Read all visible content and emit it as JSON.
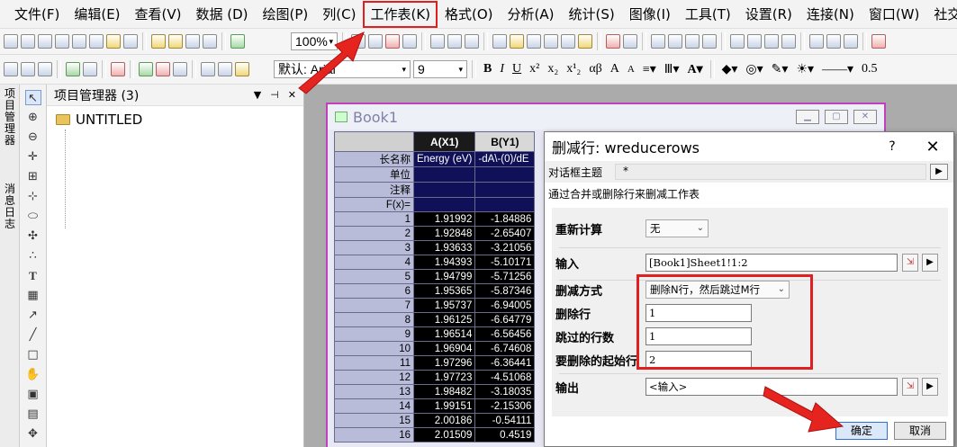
{
  "menubar": {
    "items": [
      "文件(F)",
      "编辑(E)",
      "查看(V)",
      "数据 (D)",
      "绘图(P)",
      "列(C)",
      "工作表(K)",
      "格式(O)",
      "分析(A)",
      "统计(S)",
      "图像(I)",
      "工具(T)",
      "设置(R)",
      "连接(N)",
      "窗口(W)",
      "社交("
    ],
    "highlighted_index": 6
  },
  "toolbar1": {
    "zoom": "100%"
  },
  "toolbar2": {
    "font_label": "默认: Arial",
    "font_size": "9",
    "format_buttons": [
      "B",
      "I",
      "U",
      "x²",
      "x₂",
      "x¹₂",
      "αβ",
      "A",
      "A"
    ],
    "line_width": "0.5"
  },
  "side_tabs": {
    "top": "项目管理器",
    "bottom": "消息日志"
  },
  "project_explorer": {
    "title": "项目管理器 (3)",
    "folder": "UNTITLED"
  },
  "book": {
    "title": "Book1"
  },
  "grid": {
    "columns": [
      "A(X1)",
      "B(Y1)"
    ],
    "label_rows": [
      {
        "name": "长名称",
        "a": "Energy (eV)",
        "b": "-dA\\-(0)/dE"
      },
      {
        "name": "单位",
        "a": "",
        "b": ""
      },
      {
        "name": "注释",
        "a": "",
        "b": ""
      },
      {
        "name": "F(x)=",
        "a": "",
        "b": ""
      }
    ],
    "rows": [
      {
        "n": "1",
        "a": "1.91992",
        "b": "-1.84886"
      },
      {
        "n": "2",
        "a": "1.92848",
        "b": "-2.65407"
      },
      {
        "n": "3",
        "a": "1.93633",
        "b": "-3.21056"
      },
      {
        "n": "4",
        "a": "1.94393",
        "b": "-5.10171"
      },
      {
        "n": "5",
        "a": "1.94799",
        "b": "-5.71256"
      },
      {
        "n": "6",
        "a": "1.95365",
        "b": "-5.87346"
      },
      {
        "n": "7",
        "a": "1.95737",
        "b": "-6.94005"
      },
      {
        "n": "8",
        "a": "1.96125",
        "b": "-6.64779"
      },
      {
        "n": "9",
        "a": "1.96514",
        "b": "-6.56456"
      },
      {
        "n": "10",
        "a": "1.96904",
        "b": "-6.74608"
      },
      {
        "n": "11",
        "a": "1.97296",
        "b": "-6.36441"
      },
      {
        "n": "12",
        "a": "1.97723",
        "b": "-4.51068"
      },
      {
        "n": "13",
        "a": "1.98482",
        "b": "-3.18035"
      },
      {
        "n": "14",
        "a": "1.99151",
        "b": "-2.15306"
      },
      {
        "n": "15",
        "a": "2.00186",
        "b": "-0.54111"
      },
      {
        "n": "16",
        "a": "2.01509",
        "b": "0.4519"
      }
    ]
  },
  "dialog": {
    "title": "删减行: wreducerows",
    "help": "?",
    "close": "✕",
    "theme_label": "对话框主题",
    "theme_value": "*",
    "description": "通过合并或删除行来删减工作表",
    "recalc_label": "重新计算",
    "recalc_value": "无",
    "input_label": "输入",
    "input_value": "[Book1]Sheet1!1:2",
    "method_label": "删减方式",
    "method_value": "删除N行，然后跳过M行",
    "delete_label": "删除行",
    "delete_value": "1",
    "skip_label": "跳过的行数",
    "skip_value": "1",
    "start_label": "要删除的起始行",
    "start_value": "2",
    "output_label": "输出",
    "output_value": "<输入>",
    "ok": "确定",
    "cancel": "取消"
  },
  "colors": {
    "highlight_red": "#e02020",
    "book_border": "#c040c0",
    "selected_col": "#101058"
  }
}
